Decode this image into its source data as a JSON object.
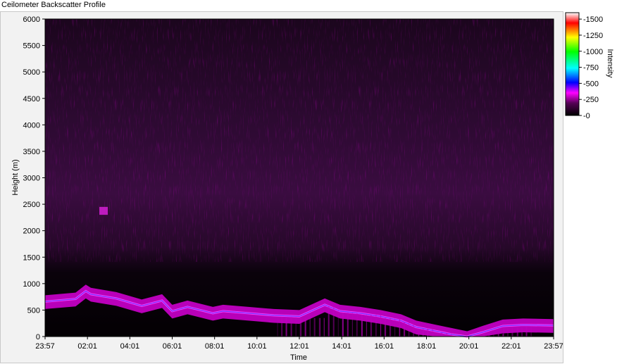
{
  "window": {
    "title": "Ceilometer Backscatter Profile"
  },
  "chart_data": {
    "type": "heatmap",
    "title": "Ceilometer Backscatter Profile",
    "xlabel": "Time",
    "ylabel": "Height (m)",
    "x_tick_labels": [
      "23:57",
      "02:01",
      "04:01",
      "06:01",
      "08:01",
      "10:01",
      "12:01",
      "14:01",
      "16:01",
      "18:01",
      "20:01",
      "22:01",
      "23:57"
    ],
    "y_ticks": [
      0,
      500,
      1000,
      1500,
      2000,
      2500,
      3000,
      3500,
      4000,
      4500,
      5000,
      5500,
      6000
    ],
    "ylim": [
      0,
      6000
    ],
    "colorbar": {
      "label": "Intensity",
      "ticks": [
        0,
        250,
        500,
        750,
        1000,
        1250,
        1500
      ],
      "range": [
        0,
        1600
      ],
      "colors": [
        "#000000",
        "#ff00ff",
        "#0000ff",
        "#00ffff",
        "#00ff00",
        "#ffff00",
        "#ff0000",
        "#ffffff"
      ]
    },
    "grid": false,
    "aerosol_layer_top_m": [
      {
        "t": 0.0,
        "h": 780
      },
      {
        "t": 0.06,
        "h": 830
      },
      {
        "t": 0.08,
        "h": 980
      },
      {
        "t": 0.09,
        "h": 920
      },
      {
        "t": 0.14,
        "h": 840
      },
      {
        "t": 0.19,
        "h": 700
      },
      {
        "t": 0.23,
        "h": 800
      },
      {
        "t": 0.25,
        "h": 600
      },
      {
        "t": 0.28,
        "h": 680
      },
      {
        "t": 0.33,
        "h": 560
      },
      {
        "t": 0.35,
        "h": 600
      },
      {
        "t": 0.4,
        "h": 560
      },
      {
        "t": 0.45,
        "h": 520
      },
      {
        "t": 0.5,
        "h": 500
      },
      {
        "t": 0.55,
        "h": 720
      },
      {
        "t": 0.58,
        "h": 600
      },
      {
        "t": 0.62,
        "h": 560
      },
      {
        "t": 0.66,
        "h": 500
      },
      {
        "t": 0.7,
        "h": 420
      },
      {
        "t": 0.73,
        "h": 300
      },
      {
        "t": 0.77,
        "h": 220
      },
      {
        "t": 0.8,
        "h": 160
      },
      {
        "t": 0.83,
        "h": 100
      },
      {
        "t": 0.86,
        "h": 200
      },
      {
        "t": 0.9,
        "h": 320
      },
      {
        "t": 0.94,
        "h": 340
      },
      {
        "t": 1.0,
        "h": 330
      }
    ],
    "elevated_feature": {
      "t": 0.115,
      "h_low": 2300,
      "h_high": 2450
    }
  }
}
